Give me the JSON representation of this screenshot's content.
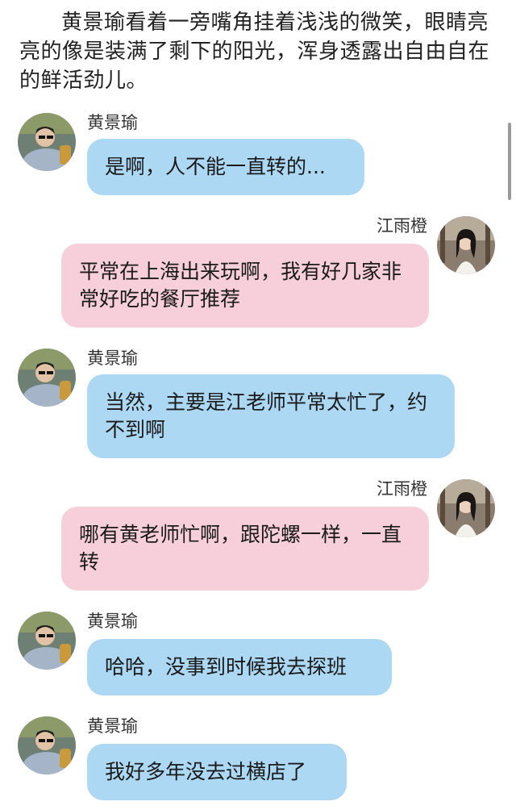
{
  "narration": "黄景瑜看着一旁嘴角挂着浅浅的微笑，眼睛亮亮的像是装满了剩下的阳光，浑身透露出自由自在的鲜活劲儿。",
  "colors": {
    "left_bubble": "#acd8f4",
    "right_bubble": "#f6cfda",
    "background": "#ffffff"
  },
  "messages": [
    {
      "side": "left",
      "sender": "黄景瑜",
      "text": "是啊，人不能一直转的..."
    },
    {
      "side": "right",
      "sender": "江雨橙",
      "text": "平常在上海出来玩啊，我有好几家非常好吃的餐厅推荐"
    },
    {
      "side": "left",
      "sender": "黄景瑜",
      "text": "当然，主要是江老师平常太忙了，约不到啊"
    },
    {
      "side": "right",
      "sender": "江雨橙",
      "text": "哪有黄老师忙啊，跟陀螺一样，一直转"
    },
    {
      "side": "left",
      "sender": "黄景瑜",
      "text": "哈哈，没事到时候我去探班"
    },
    {
      "side": "left",
      "sender": "黄景瑜",
      "text": "我好多年没去过横店了"
    }
  ],
  "icons": {
    "left_avatar": "avatar-photo",
    "right_avatar": "avatar-photo"
  }
}
